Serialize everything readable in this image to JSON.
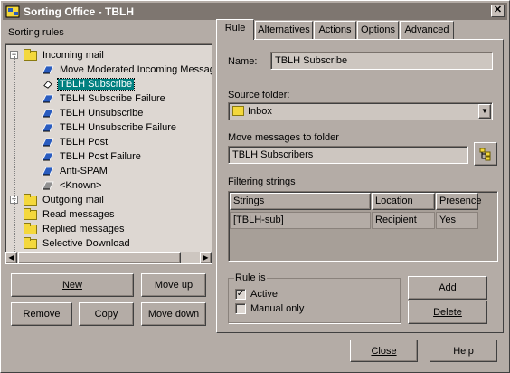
{
  "window": {
    "title": "Sorting Office - TBLH",
    "close_symbol": "✕"
  },
  "left": {
    "header": "Sorting rules",
    "tree": [
      {
        "label": "Incoming mail",
        "type": "folder",
        "expander": "−"
      },
      {
        "label": "Move Moderated Incoming Messag",
        "type": "rule"
      },
      {
        "label": "TBLH Subscribe",
        "type": "rule-edit",
        "selected": true
      },
      {
        "label": "TBLH Subscribe Failure",
        "type": "rule"
      },
      {
        "label": "TBLH Unsubscribe",
        "type": "rule"
      },
      {
        "label": "TBLH Unsubscribe Failure",
        "type": "rule"
      },
      {
        "label": "TBLH Post",
        "type": "rule"
      },
      {
        "label": "TBLH Post Failure",
        "type": "rule"
      },
      {
        "label": "Anti-SPAM",
        "type": "rule"
      },
      {
        "label": "<Known>",
        "type": "rule-gray"
      },
      {
        "label": "Outgoing mail",
        "type": "folder",
        "expander": "+"
      },
      {
        "label": "Read messages",
        "type": "folder"
      },
      {
        "label": "Replied messages",
        "type": "folder"
      },
      {
        "label": "Selective Download",
        "type": "folder"
      }
    ],
    "buttons": {
      "new": "New",
      "move_up": "Move up",
      "remove": "Remove",
      "copy": "Copy",
      "move_down": "Move down"
    }
  },
  "tabs": [
    "Rule",
    "Alternatives",
    "Actions",
    "Options",
    "Advanced"
  ],
  "rule": {
    "name_label": "Name:",
    "name_value": "TBLH Subscribe",
    "source_label": "Source folder:",
    "source_value": "Inbox",
    "move_label": "Move messages to folder",
    "move_value": "TBLH Subscribers",
    "filtering_label": "Filtering strings",
    "columns": [
      "Strings",
      "Location",
      "Presence"
    ],
    "rows": [
      [
        "[TBLH-sub]",
        "Recipient",
        "Yes"
      ]
    ],
    "rule_is_label": "Rule is",
    "active_label": "Active",
    "active_checked": true,
    "manual_label": "Manual only",
    "manual_checked": false,
    "add": "Add",
    "delete": "Delete",
    "check_mark": "✓"
  },
  "footer": {
    "close": "Close",
    "help": "Help"
  },
  "icons": {
    "arrow_left": "◀",
    "arrow_right": "▶",
    "arrow_down": "▼"
  }
}
